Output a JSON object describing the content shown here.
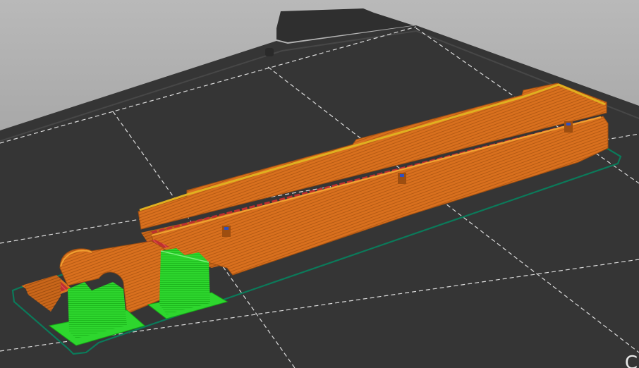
{
  "viewport": {
    "background": "#a9a9a9",
    "corner_label": "C"
  },
  "colors": {
    "bed": "#353535",
    "bed_edge": "#4a4a4a",
    "grid": "#dcdcdc",
    "wall": "#d9701e",
    "wall_dark": "#b45a14",
    "wall_light": "#f08a2a",
    "top_layer": "#e0b020",
    "infill": "#c03030",
    "support": "#2ed62e",
    "support_dark": "#16a816",
    "skirt": "#0b7a5a"
  },
  "scene": {
    "objects": [
      "print-bed",
      "bed-grid",
      "skirt-outline",
      "long-rail-part",
      "arch-part",
      "support-blocks"
    ]
  }
}
